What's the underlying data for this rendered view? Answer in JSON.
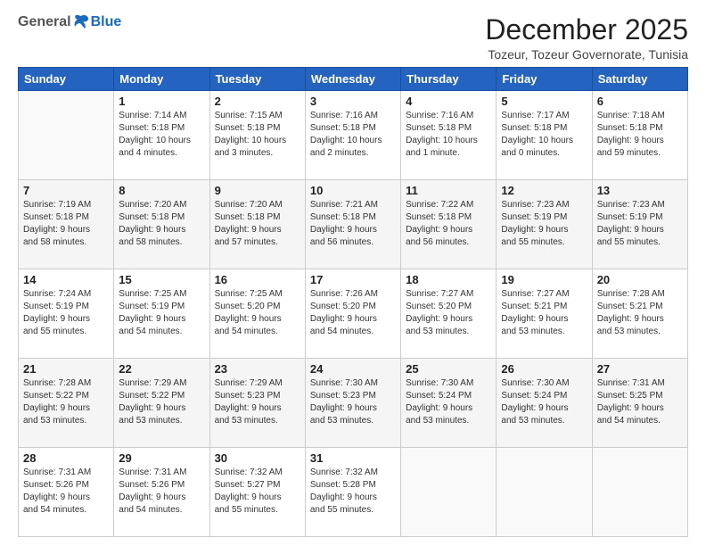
{
  "logo": {
    "general": "General",
    "blue": "Blue"
  },
  "header": {
    "title": "December 2025",
    "subtitle": "Tozeur, Tozeur Governorate, Tunisia"
  },
  "days_of_week": [
    "Sunday",
    "Monday",
    "Tuesday",
    "Wednesday",
    "Thursday",
    "Friday",
    "Saturday"
  ],
  "weeks": [
    [
      {
        "day": "",
        "info": ""
      },
      {
        "day": "1",
        "info": "Sunrise: 7:14 AM\nSunset: 5:18 PM\nDaylight: 10 hours\nand 4 minutes."
      },
      {
        "day": "2",
        "info": "Sunrise: 7:15 AM\nSunset: 5:18 PM\nDaylight: 10 hours\nand 3 minutes."
      },
      {
        "day": "3",
        "info": "Sunrise: 7:16 AM\nSunset: 5:18 PM\nDaylight: 10 hours\nand 2 minutes."
      },
      {
        "day": "4",
        "info": "Sunrise: 7:16 AM\nSunset: 5:18 PM\nDaylight: 10 hours\nand 1 minute."
      },
      {
        "day": "5",
        "info": "Sunrise: 7:17 AM\nSunset: 5:18 PM\nDaylight: 10 hours\nand 0 minutes."
      },
      {
        "day": "6",
        "info": "Sunrise: 7:18 AM\nSunset: 5:18 PM\nDaylight: 9 hours\nand 59 minutes."
      }
    ],
    [
      {
        "day": "7",
        "info": "Sunrise: 7:19 AM\nSunset: 5:18 PM\nDaylight: 9 hours\nand 58 minutes."
      },
      {
        "day": "8",
        "info": "Sunrise: 7:20 AM\nSunset: 5:18 PM\nDaylight: 9 hours\nand 58 minutes."
      },
      {
        "day": "9",
        "info": "Sunrise: 7:20 AM\nSunset: 5:18 PM\nDaylight: 9 hours\nand 57 minutes."
      },
      {
        "day": "10",
        "info": "Sunrise: 7:21 AM\nSunset: 5:18 PM\nDaylight: 9 hours\nand 56 minutes."
      },
      {
        "day": "11",
        "info": "Sunrise: 7:22 AM\nSunset: 5:18 PM\nDaylight: 9 hours\nand 56 minutes."
      },
      {
        "day": "12",
        "info": "Sunrise: 7:23 AM\nSunset: 5:19 PM\nDaylight: 9 hours\nand 55 minutes."
      },
      {
        "day": "13",
        "info": "Sunrise: 7:23 AM\nSunset: 5:19 PM\nDaylight: 9 hours\nand 55 minutes."
      }
    ],
    [
      {
        "day": "14",
        "info": "Sunrise: 7:24 AM\nSunset: 5:19 PM\nDaylight: 9 hours\nand 55 minutes."
      },
      {
        "day": "15",
        "info": "Sunrise: 7:25 AM\nSunset: 5:19 PM\nDaylight: 9 hours\nand 54 minutes."
      },
      {
        "day": "16",
        "info": "Sunrise: 7:25 AM\nSunset: 5:20 PM\nDaylight: 9 hours\nand 54 minutes."
      },
      {
        "day": "17",
        "info": "Sunrise: 7:26 AM\nSunset: 5:20 PM\nDaylight: 9 hours\nand 54 minutes."
      },
      {
        "day": "18",
        "info": "Sunrise: 7:27 AM\nSunset: 5:20 PM\nDaylight: 9 hours\nand 53 minutes."
      },
      {
        "day": "19",
        "info": "Sunrise: 7:27 AM\nSunset: 5:21 PM\nDaylight: 9 hours\nand 53 minutes."
      },
      {
        "day": "20",
        "info": "Sunrise: 7:28 AM\nSunset: 5:21 PM\nDaylight: 9 hours\nand 53 minutes."
      }
    ],
    [
      {
        "day": "21",
        "info": "Sunrise: 7:28 AM\nSunset: 5:22 PM\nDaylight: 9 hours\nand 53 minutes."
      },
      {
        "day": "22",
        "info": "Sunrise: 7:29 AM\nSunset: 5:22 PM\nDaylight: 9 hours\nand 53 minutes."
      },
      {
        "day": "23",
        "info": "Sunrise: 7:29 AM\nSunset: 5:23 PM\nDaylight: 9 hours\nand 53 minutes."
      },
      {
        "day": "24",
        "info": "Sunrise: 7:30 AM\nSunset: 5:23 PM\nDaylight: 9 hours\nand 53 minutes."
      },
      {
        "day": "25",
        "info": "Sunrise: 7:30 AM\nSunset: 5:24 PM\nDaylight: 9 hours\nand 53 minutes."
      },
      {
        "day": "26",
        "info": "Sunrise: 7:30 AM\nSunset: 5:24 PM\nDaylight: 9 hours\nand 53 minutes."
      },
      {
        "day": "27",
        "info": "Sunrise: 7:31 AM\nSunset: 5:25 PM\nDaylight: 9 hours\nand 54 minutes."
      }
    ],
    [
      {
        "day": "28",
        "info": "Sunrise: 7:31 AM\nSunset: 5:26 PM\nDaylight: 9 hours\nand 54 minutes."
      },
      {
        "day": "29",
        "info": "Sunrise: 7:31 AM\nSunset: 5:26 PM\nDaylight: 9 hours\nand 54 minutes."
      },
      {
        "day": "30",
        "info": "Sunrise: 7:32 AM\nSunset: 5:27 PM\nDaylight: 9 hours\nand 55 minutes."
      },
      {
        "day": "31",
        "info": "Sunrise: 7:32 AM\nSunset: 5:28 PM\nDaylight: 9 hours\nand 55 minutes."
      },
      {
        "day": "",
        "info": ""
      },
      {
        "day": "",
        "info": ""
      },
      {
        "day": "",
        "info": ""
      }
    ]
  ]
}
